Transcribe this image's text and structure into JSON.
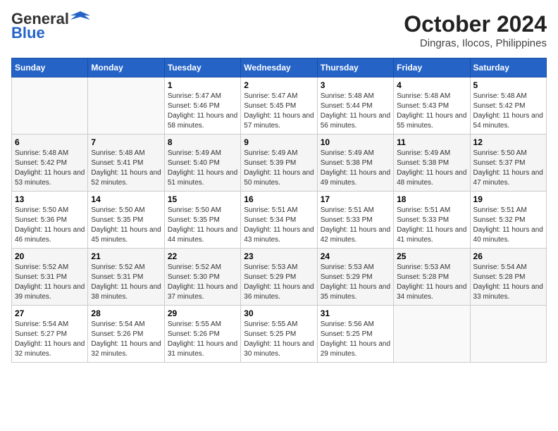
{
  "header": {
    "logo_line1": "General",
    "logo_line2": "Blue",
    "month": "October 2024",
    "location": "Dingras, Ilocos, Philippines"
  },
  "weekdays": [
    "Sunday",
    "Monday",
    "Tuesday",
    "Wednesday",
    "Thursday",
    "Friday",
    "Saturday"
  ],
  "weeks": [
    [
      {
        "day": "",
        "info": ""
      },
      {
        "day": "",
        "info": ""
      },
      {
        "day": "1",
        "info": "Sunrise: 5:47 AM\nSunset: 5:46 PM\nDaylight: 11 hours and 58 minutes."
      },
      {
        "day": "2",
        "info": "Sunrise: 5:47 AM\nSunset: 5:45 PM\nDaylight: 11 hours and 57 minutes."
      },
      {
        "day": "3",
        "info": "Sunrise: 5:48 AM\nSunset: 5:44 PM\nDaylight: 11 hours and 56 minutes."
      },
      {
        "day": "4",
        "info": "Sunrise: 5:48 AM\nSunset: 5:43 PM\nDaylight: 11 hours and 55 minutes."
      },
      {
        "day": "5",
        "info": "Sunrise: 5:48 AM\nSunset: 5:42 PM\nDaylight: 11 hours and 54 minutes."
      }
    ],
    [
      {
        "day": "6",
        "info": "Sunrise: 5:48 AM\nSunset: 5:42 PM\nDaylight: 11 hours and 53 minutes."
      },
      {
        "day": "7",
        "info": "Sunrise: 5:48 AM\nSunset: 5:41 PM\nDaylight: 11 hours and 52 minutes."
      },
      {
        "day": "8",
        "info": "Sunrise: 5:49 AM\nSunset: 5:40 PM\nDaylight: 11 hours and 51 minutes."
      },
      {
        "day": "9",
        "info": "Sunrise: 5:49 AM\nSunset: 5:39 PM\nDaylight: 11 hours and 50 minutes."
      },
      {
        "day": "10",
        "info": "Sunrise: 5:49 AM\nSunset: 5:38 PM\nDaylight: 11 hours and 49 minutes."
      },
      {
        "day": "11",
        "info": "Sunrise: 5:49 AM\nSunset: 5:38 PM\nDaylight: 11 hours and 48 minutes."
      },
      {
        "day": "12",
        "info": "Sunrise: 5:50 AM\nSunset: 5:37 PM\nDaylight: 11 hours and 47 minutes."
      }
    ],
    [
      {
        "day": "13",
        "info": "Sunrise: 5:50 AM\nSunset: 5:36 PM\nDaylight: 11 hours and 46 minutes."
      },
      {
        "day": "14",
        "info": "Sunrise: 5:50 AM\nSunset: 5:35 PM\nDaylight: 11 hours and 45 minutes."
      },
      {
        "day": "15",
        "info": "Sunrise: 5:50 AM\nSunset: 5:35 PM\nDaylight: 11 hours and 44 minutes."
      },
      {
        "day": "16",
        "info": "Sunrise: 5:51 AM\nSunset: 5:34 PM\nDaylight: 11 hours and 43 minutes."
      },
      {
        "day": "17",
        "info": "Sunrise: 5:51 AM\nSunset: 5:33 PM\nDaylight: 11 hours and 42 minutes."
      },
      {
        "day": "18",
        "info": "Sunrise: 5:51 AM\nSunset: 5:33 PM\nDaylight: 11 hours and 41 minutes."
      },
      {
        "day": "19",
        "info": "Sunrise: 5:51 AM\nSunset: 5:32 PM\nDaylight: 11 hours and 40 minutes."
      }
    ],
    [
      {
        "day": "20",
        "info": "Sunrise: 5:52 AM\nSunset: 5:31 PM\nDaylight: 11 hours and 39 minutes."
      },
      {
        "day": "21",
        "info": "Sunrise: 5:52 AM\nSunset: 5:31 PM\nDaylight: 11 hours and 38 minutes."
      },
      {
        "day": "22",
        "info": "Sunrise: 5:52 AM\nSunset: 5:30 PM\nDaylight: 11 hours and 37 minutes."
      },
      {
        "day": "23",
        "info": "Sunrise: 5:53 AM\nSunset: 5:29 PM\nDaylight: 11 hours and 36 minutes."
      },
      {
        "day": "24",
        "info": "Sunrise: 5:53 AM\nSunset: 5:29 PM\nDaylight: 11 hours and 35 minutes."
      },
      {
        "day": "25",
        "info": "Sunrise: 5:53 AM\nSunset: 5:28 PM\nDaylight: 11 hours and 34 minutes."
      },
      {
        "day": "26",
        "info": "Sunrise: 5:54 AM\nSunset: 5:28 PM\nDaylight: 11 hours and 33 minutes."
      }
    ],
    [
      {
        "day": "27",
        "info": "Sunrise: 5:54 AM\nSunset: 5:27 PM\nDaylight: 11 hours and 32 minutes."
      },
      {
        "day": "28",
        "info": "Sunrise: 5:54 AM\nSunset: 5:26 PM\nDaylight: 11 hours and 32 minutes."
      },
      {
        "day": "29",
        "info": "Sunrise: 5:55 AM\nSunset: 5:26 PM\nDaylight: 11 hours and 31 minutes."
      },
      {
        "day": "30",
        "info": "Sunrise: 5:55 AM\nSunset: 5:25 PM\nDaylight: 11 hours and 30 minutes."
      },
      {
        "day": "31",
        "info": "Sunrise: 5:56 AM\nSunset: 5:25 PM\nDaylight: 11 hours and 29 minutes."
      },
      {
        "day": "",
        "info": ""
      },
      {
        "day": "",
        "info": ""
      }
    ]
  ]
}
